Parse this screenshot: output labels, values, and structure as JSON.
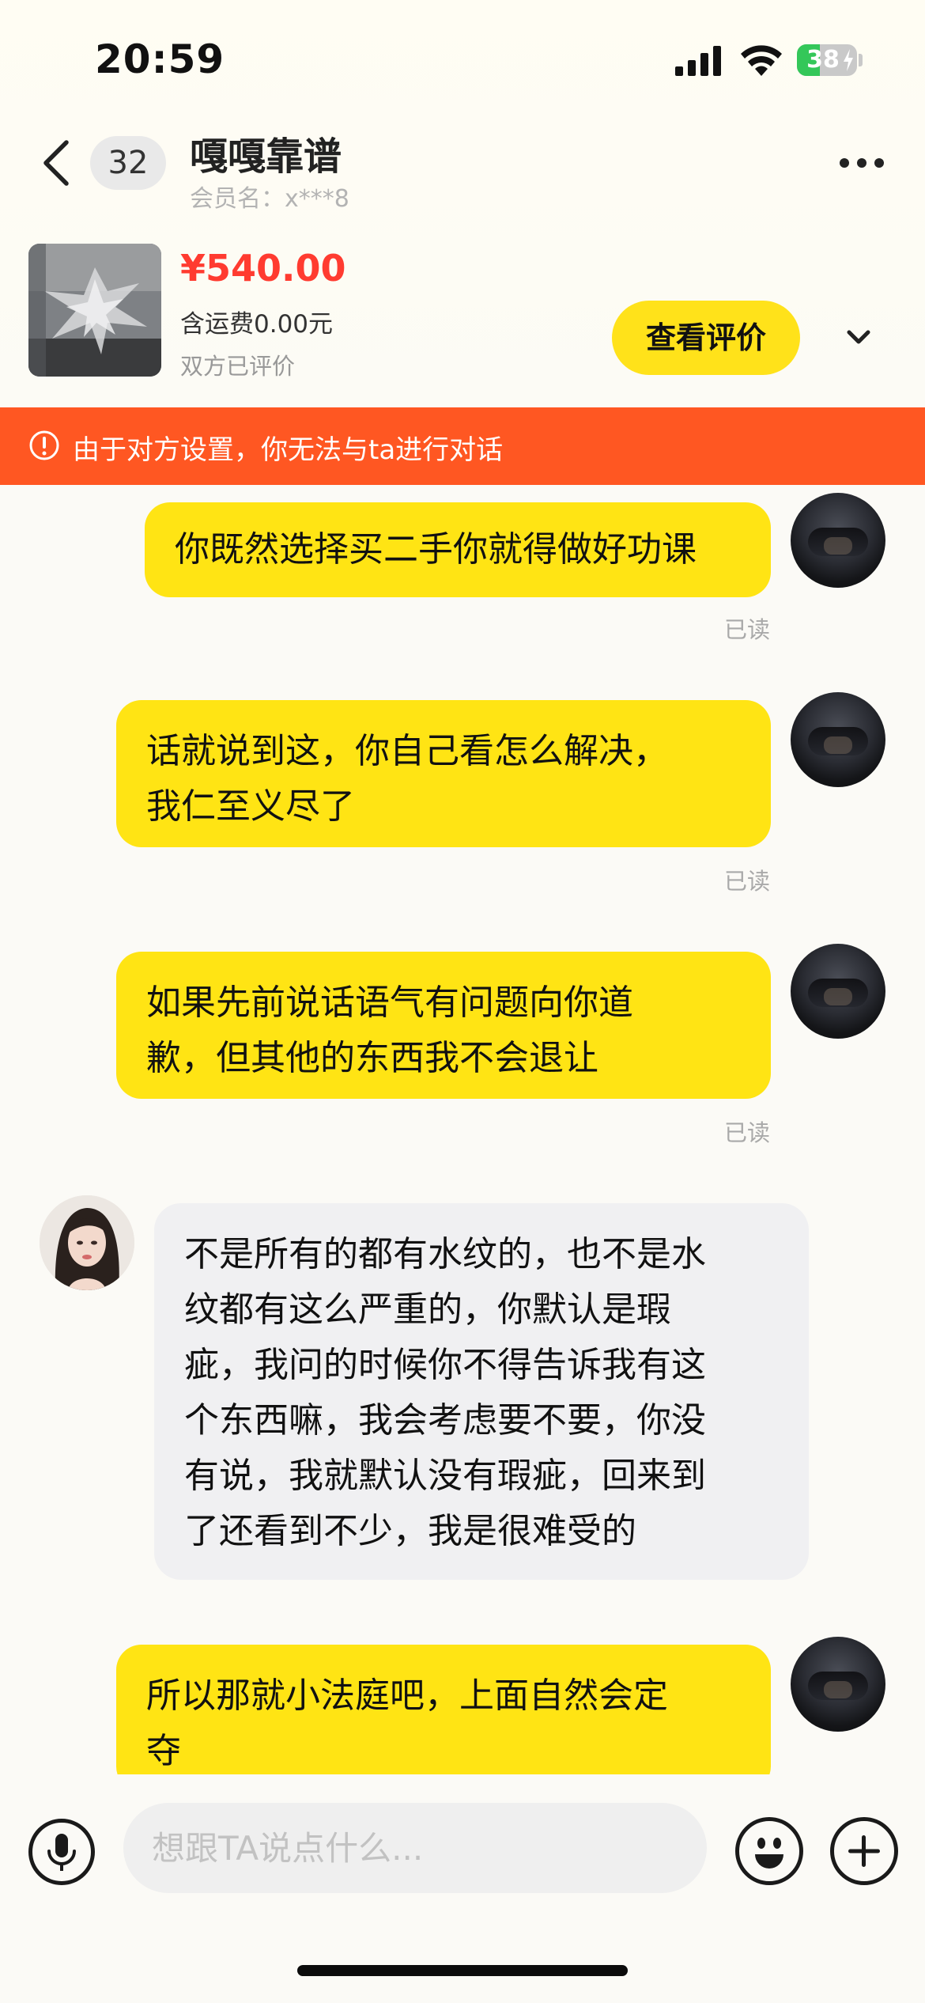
{
  "status_bar": {
    "time": "20:59",
    "battery_level": "38",
    "battery_percent": 38,
    "battery_color": "#34c759"
  },
  "header": {
    "unread_count": "32",
    "title": "嘎嘎靠谱",
    "member_name": "会员名：x***8",
    "back_icon": "chevron-left-icon",
    "more_icon": "ellipsis-icon"
  },
  "product": {
    "price": "¥540.00",
    "shipping": "含运费0.00元",
    "review_status": "双方已评价",
    "view_review_label": "查看评价",
    "price_color": "#ff3b30",
    "button_color": "#ffe21a"
  },
  "warning": {
    "text": "由于对方设置，你无法与ta进行对话",
    "icon": "alert-circle-icon",
    "color": "#ff5722"
  },
  "messages": [
    {
      "sender": "me",
      "lines": [
        "你既然选择买二手你就得做好功课"
      ],
      "read": "已读"
    },
    {
      "sender": "me",
      "lines": [
        "话就说到这，你自己看怎么解决，",
        "我仁至义尽了"
      ],
      "read": "已读"
    },
    {
      "sender": "me",
      "lines": [
        "如果先前说话语气有问题向你道",
        "歉，但其他的东西我不会退让"
      ],
      "read": "已读"
    },
    {
      "sender": "them",
      "lines": [
        "不是所有的都有水纹的，也不是水",
        "纹都有这么严重的，你默认是瑕",
        "疵，我问的时候你不得告诉我有这",
        "个东西嘛，我会考虑要不要，你没",
        "有说，我就默认没有瑕疵，回来到",
        "了还看到不少，我是很难受的"
      ]
    },
    {
      "sender": "me",
      "lines": [
        "所以那就小法庭吧，上面自然会定",
        "夺"
      ]
    }
  ],
  "input_bar": {
    "placeholder": "想跟TA说点什么...",
    "voice_icon": "microphone-icon",
    "emoji_icon": "emoji-icon",
    "add_icon": "plus-icon"
  }
}
